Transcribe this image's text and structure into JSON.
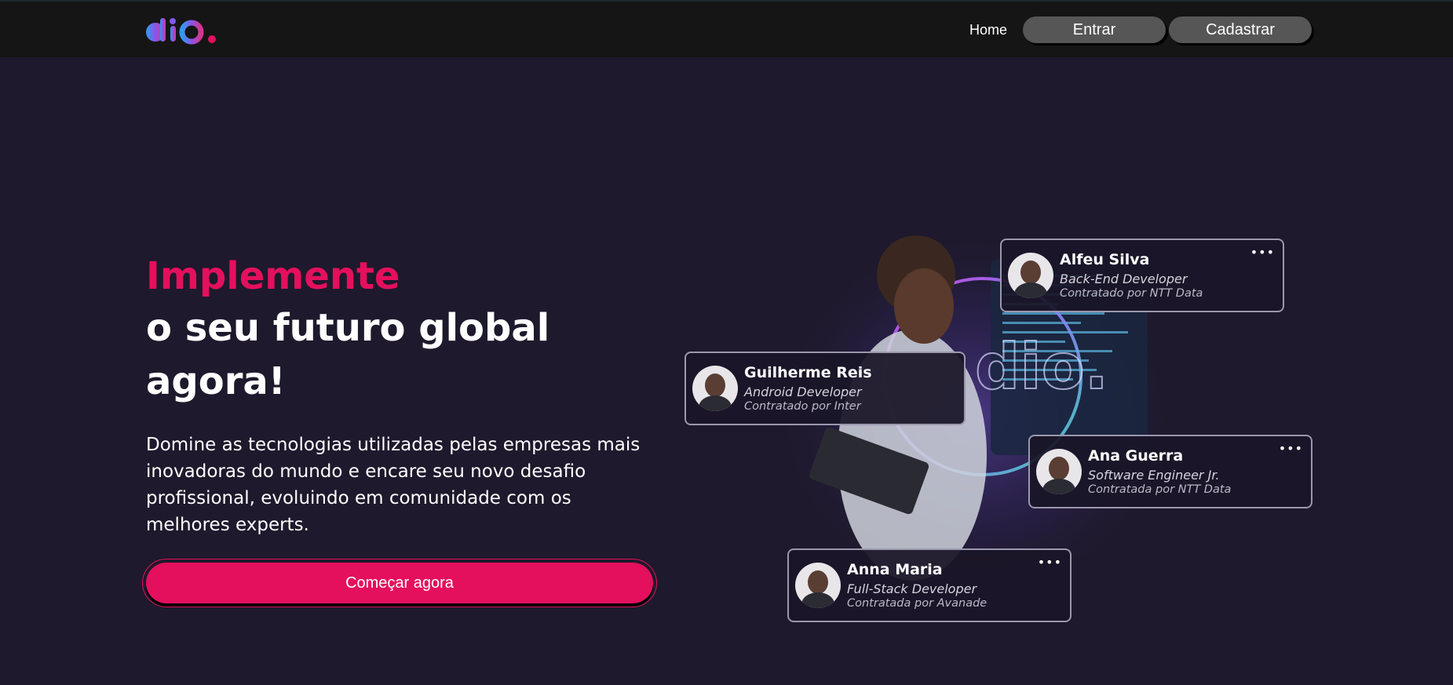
{
  "header": {
    "logo_text": "dio.",
    "nav": {
      "home": "Home",
      "login": "Entrar",
      "signup": "Cadastrar"
    }
  },
  "hero": {
    "headline_accent": "Implemente",
    "headline": "o seu futuro global agora!",
    "description": "Domine as tecnologias utilizadas pelas empresas mais inovadoras do mundo e encare seu novo desafio profissional, evoluindo em comunidade com os melhores experts.",
    "cta": "Começar agora"
  },
  "cards": [
    {
      "name": "Alfeu Silva",
      "role": "Back-End Developer",
      "hired": "Contratado por NTT Data",
      "menu": "•••"
    },
    {
      "name": "Guilherme Reis",
      "role": "Android Developer",
      "hired": "Contratado por Inter",
      "menu": ""
    },
    {
      "name": "Ana Guerra",
      "role": "Software Engineer Jr.",
      "hired": "Contratada por NTT Data",
      "menu": "•••"
    },
    {
      "name": "Anna Maria",
      "role": "Full-Stack Developer",
      "hired": "Contratada por Avanade",
      "menu": "•••"
    }
  ],
  "colors": {
    "accent": "#e4105d",
    "background": "#1e192c",
    "topbar": "#151515",
    "button_gray": "#565656"
  }
}
